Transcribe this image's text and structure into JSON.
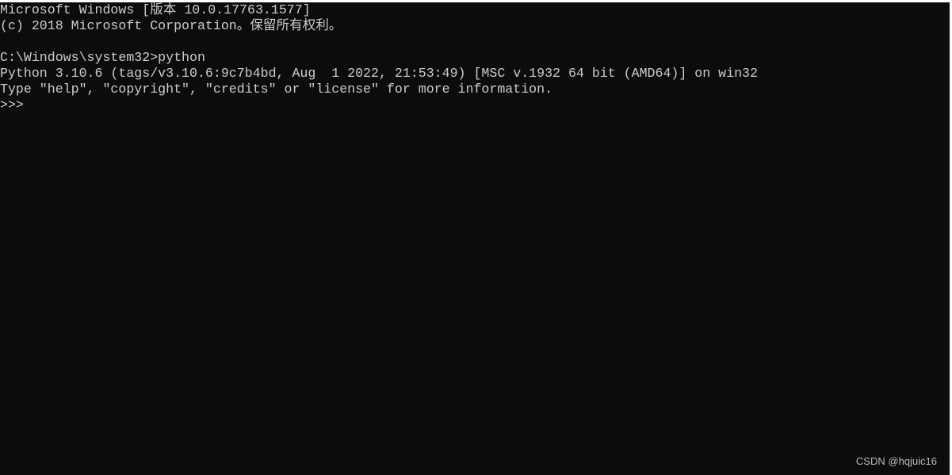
{
  "terminal": {
    "lines": [
      "Microsoft Windows [版本 10.0.17763.1577]",
      "(c) 2018 Microsoft Corporation。保留所有权利。",
      "",
      "C:\\Windows\\system32>python",
      "Python 3.10.6 (tags/v3.10.6:9c7b4bd, Aug  1 2022, 21:53:49) [MSC v.1932 64 bit (AMD64)] on win32",
      "Type \"help\", \"copyright\", \"credits\" or \"license\" for more information.",
      ">>> "
    ],
    "background": "#0c0c0c",
    "foreground": "#cccccc"
  },
  "watermark": "CSDN @hqjuic16"
}
